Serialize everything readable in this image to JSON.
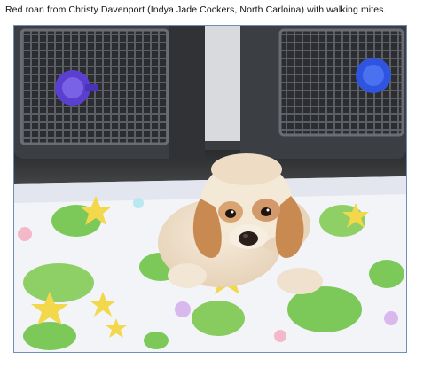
{
  "caption": "Red roan from Christy Davenport (Indya Jade Cockers, North Carloina) with walking mites.",
  "photo": {
    "subject": "cocker spaniel puppy",
    "colors": {
      "crate_dark": "#3b3e42",
      "latch_purple": "#5a3fd0",
      "latch_blue": "#2f55e0",
      "blanket": "#f3f4f8",
      "frog_green": "#7cc95a",
      "star_yellow": "#f2d84a",
      "fur_cream": "#f2e2cc",
      "fur_red": "#c98a52"
    }
  }
}
